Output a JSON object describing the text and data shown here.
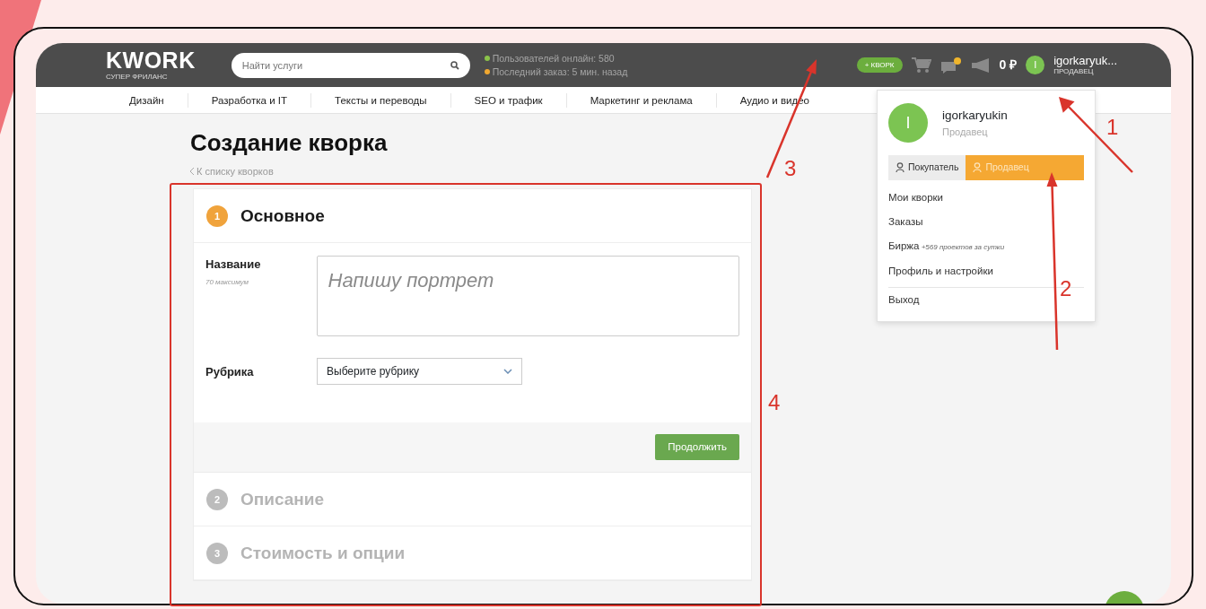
{
  "header": {
    "logo": "KWORK",
    "tagline": "СУПЕР ФРИЛАНС",
    "search": {
      "placeholder": "Найти услуги"
    },
    "stats": [
      {
        "text": "Пользователей онлайн: 580",
        "color": "#8bc34a"
      },
      {
        "text": "Последний заказ: 5 мин. назад",
        "color": "#f0a830"
      }
    ],
    "add_button": "+ КВОРК",
    "balance": "0 ₽",
    "user": {
      "avatar": "I",
      "name": "igorkaryuk...",
      "role": "ПРОДАВЕЦ"
    }
  },
  "categories": [
    "Дизайн",
    "Разработка и IT",
    "Тексты и переводы",
    "SEO и трафик",
    "Маркетинг и реклама",
    "Аудио и видео"
  ],
  "user_menu": {
    "avatar": "I",
    "name": "igorkaryukin",
    "role": "Продавец",
    "modes": [
      {
        "label": "Покупатель",
        "selected": false
      },
      {
        "label": "Продавец",
        "selected": true
      }
    ],
    "items": [
      {
        "label": "Мои кворки",
        "separated": false
      },
      {
        "label": "Заказы",
        "separated": false
      },
      {
        "label": "Биржа",
        "note": "+569 проектов за сутки",
        "separated": false
      },
      {
        "label": "Профиль и настройки",
        "separated": false
      },
      {
        "label": "Выход",
        "separated": true
      }
    ]
  },
  "page": {
    "title": "Создание кворка",
    "back_link": "К списку кворков"
  },
  "steps": [
    {
      "number": "1",
      "title": "Основное",
      "active": true
    },
    {
      "number": "2",
      "title": "Описание",
      "active": false
    },
    {
      "number": "3",
      "title": "Стоимость и опции",
      "active": false
    }
  ],
  "form": {
    "fields": [
      {
        "kind": "textarea",
        "label": "Название",
        "hint": "70 максимум",
        "placeholder": "Напишу портрет"
      },
      {
        "kind": "select",
        "label": "Рубрика",
        "value": "Выберите рубрику"
      }
    ],
    "submit": "Продолжить"
  },
  "annotations": [
    {
      "kind": "arrow",
      "label": "1"
    },
    {
      "kind": "arrow",
      "label": "2"
    },
    {
      "kind": "arrow",
      "label": "3"
    },
    {
      "kind": "box",
      "label": "4"
    }
  ]
}
